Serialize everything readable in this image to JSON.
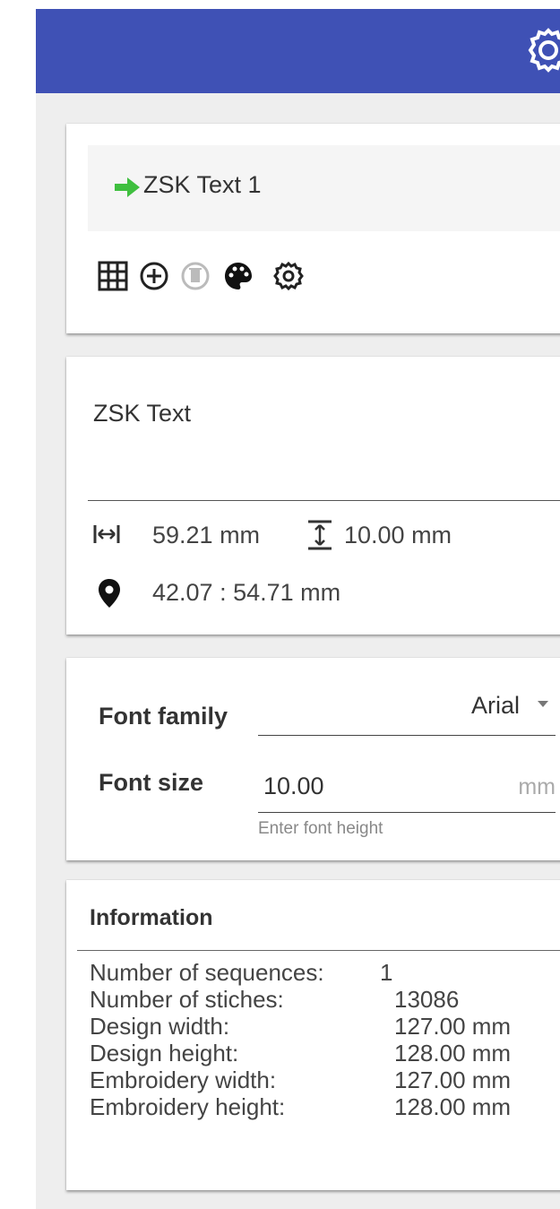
{
  "header": {
    "settings_icon": "gear-icon",
    "color": "#3f51b5"
  },
  "layer": {
    "name": "ZSK Text 1",
    "arrow_color": "#3fbf3f"
  },
  "toolbar": {
    "icons": [
      "grid-icon",
      "add-circle-icon",
      "delete-icon",
      "palette-icon",
      "gear-icon"
    ]
  },
  "text_object": {
    "text_value": "ZSK Text",
    "width": "59.21 mm",
    "height": "10.00 mm",
    "position": "42.07 : 54.71 mm"
  },
  "font": {
    "family_label": "Font family",
    "family_value": "Arial",
    "size_label": "Font size",
    "size_value": "10.00",
    "size_unit": "mm",
    "size_hint": "Enter font height"
  },
  "information": {
    "title": "Information",
    "rows": [
      {
        "label": "Number of sequences:",
        "value": "1"
      },
      {
        "label": "Number of stiches:",
        "value": "13086"
      },
      {
        "label": "Design width:",
        "value": "127.00 mm"
      },
      {
        "label": "Design height:",
        "value": "128.00 mm"
      },
      {
        "label": "Embroidery width:",
        "value": "127.00 mm"
      },
      {
        "label": "Embroidery height:",
        "value": "128.00 mm"
      }
    ]
  }
}
